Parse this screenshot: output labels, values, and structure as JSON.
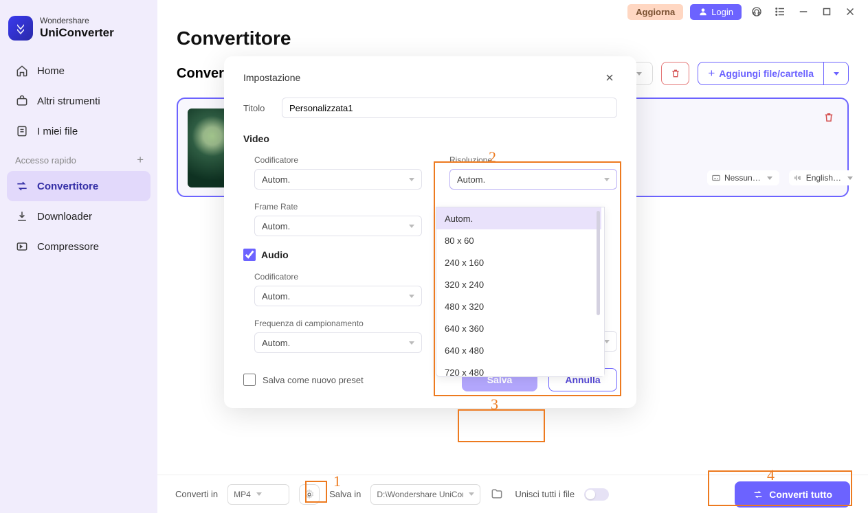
{
  "titlebar": {
    "upgrade": "Aggiorna",
    "login": "Login"
  },
  "logo": {
    "brand": "Wondershare",
    "product": "UniConverter"
  },
  "nav": {
    "home": "Home",
    "tools": "Altri strumenti",
    "myfiles": "I miei file",
    "quick": "Accesso rapido",
    "converter": "Convertitore",
    "downloader": "Downloader",
    "compressor": "Compressore"
  },
  "page": {
    "title": "Convertitore",
    "subtitle": "Conversi"
  },
  "actions": {
    "addfile": "Aggiungi file/cartella"
  },
  "card": {
    "subtitle": "Nessun…",
    "audio": "English…"
  },
  "modal": {
    "title": "Impostazione",
    "label_title": "Titolo",
    "title_value": "Personalizzata1",
    "video": "Video",
    "encoder": "Codificatore",
    "resolution": "Risoluzione",
    "framerate": "Frame Rate",
    "audio": "Audio",
    "audio_encoder": "Codificatore",
    "sample_rate": "Frequenza di campionamento",
    "value_auto": "Autom.",
    "save_preset": "Salva come nuovo preset",
    "save": "Salva",
    "cancel": "Annulla"
  },
  "resolution_options": [
    "Autom.",
    "80 x 60",
    "240 x 160",
    "320 x 240",
    "480 x 320",
    "640 x 360",
    "640 x 480",
    "720 x 480"
  ],
  "bottom": {
    "convert_in": "Converti in",
    "format": "MP4",
    "save_in": "Salva in",
    "path": "D:\\Wondershare UniCon",
    "merge": "Unisci tutti i file",
    "convert_all": "Converti tutto"
  },
  "callouts": {
    "c1": "1",
    "c2": "2",
    "c3": "3",
    "c4": "4"
  }
}
